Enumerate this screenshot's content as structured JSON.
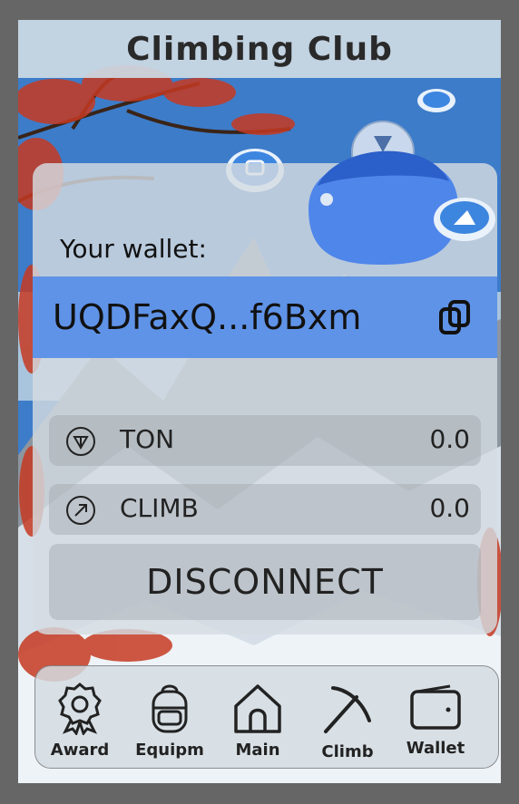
{
  "header": {
    "title": "Climbing Club"
  },
  "wallet": {
    "label": "Your wallet:",
    "address": "UQDFaxQ...f6Bxm",
    "copy_icon": "copy-icon"
  },
  "tokens": [
    {
      "name": "TON",
      "value": "0.0",
      "icon": "ton-icon"
    },
    {
      "name": "CLIMB",
      "value": "0.0",
      "icon": "climb-icon"
    }
  ],
  "disconnect_label": "DISCONNECT",
  "nav": [
    {
      "label": "Award",
      "icon": "award-icon"
    },
    {
      "label": "Equipm",
      "icon": "backpack-icon"
    },
    {
      "label": "Main",
      "icon": "home-icon"
    },
    {
      "label": "Climb",
      "icon": "pickaxe-icon"
    },
    {
      "label": "Wallet",
      "icon": "wallet-icon"
    }
  ],
  "colors": {
    "address_bar": "#5f93e7",
    "background_frame": "#666666",
    "tree_leaves": "#c63a22",
    "sky": "#2f6fbf"
  }
}
